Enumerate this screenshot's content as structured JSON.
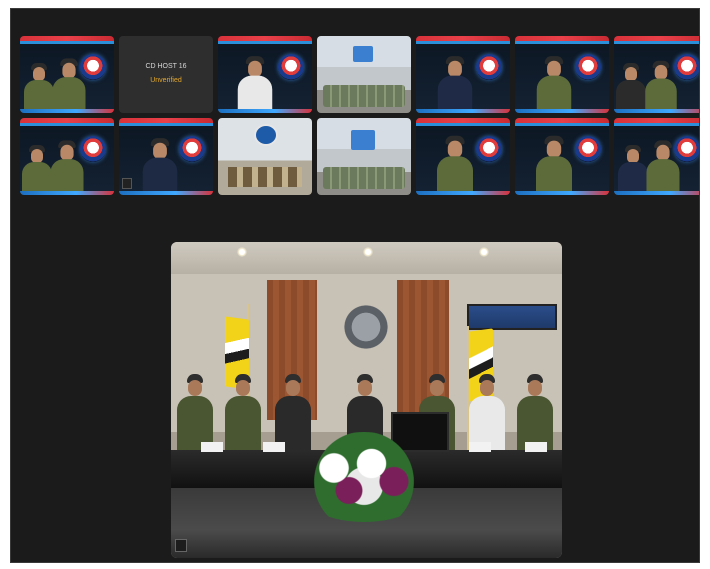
{
  "colors": {
    "window_bg": "#1b1b1b",
    "accent_red": "#d9323a",
    "accent_blue": "#2b8fd9",
    "unverified": "#e4a72a"
  },
  "gallery": {
    "placeholder_tile": {
      "host_label": "CD HOST 16",
      "status_label": "Unverified"
    }
  },
  "icons": {
    "tile_index": "tile-index-icon",
    "emblem": "rmaf-emblem-icon"
  }
}
